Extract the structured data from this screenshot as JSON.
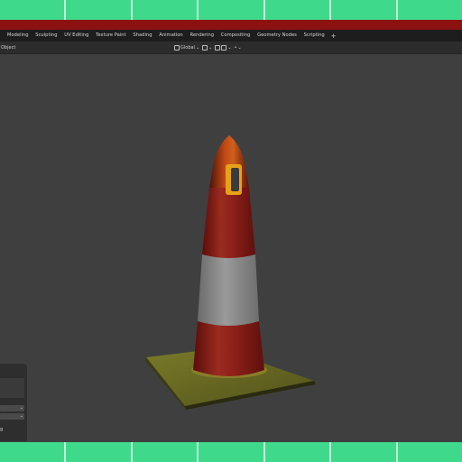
{
  "workspace_tabs": [
    {
      "label": "Modeling",
      "active": false
    },
    {
      "label": "Sculpting",
      "active": false
    },
    {
      "label": "UV Editing",
      "active": false
    },
    {
      "label": "Texture Paint",
      "active": false
    },
    {
      "label": "Shading",
      "active": false
    },
    {
      "label": "Animation",
      "active": false
    },
    {
      "label": "Rendering",
      "active": false
    },
    {
      "label": "Compositing",
      "active": false
    },
    {
      "label": "Geometry Nodes",
      "active": false
    },
    {
      "label": "Scripting",
      "active": false
    }
  ],
  "add_workspace_label": "+",
  "header": {
    "mode_label": "Object",
    "orientation_label": "Global"
  },
  "panel": {
    "field_1": "",
    "field_2": "",
    "footer_text": "g"
  },
  "colors": {
    "accent_green": "#3fd98b",
    "title_red": "#8c1212",
    "cone_red": "#8e1d1a",
    "cone_stripe": "#8a8a8a",
    "base_olive": "#6b6a22"
  }
}
